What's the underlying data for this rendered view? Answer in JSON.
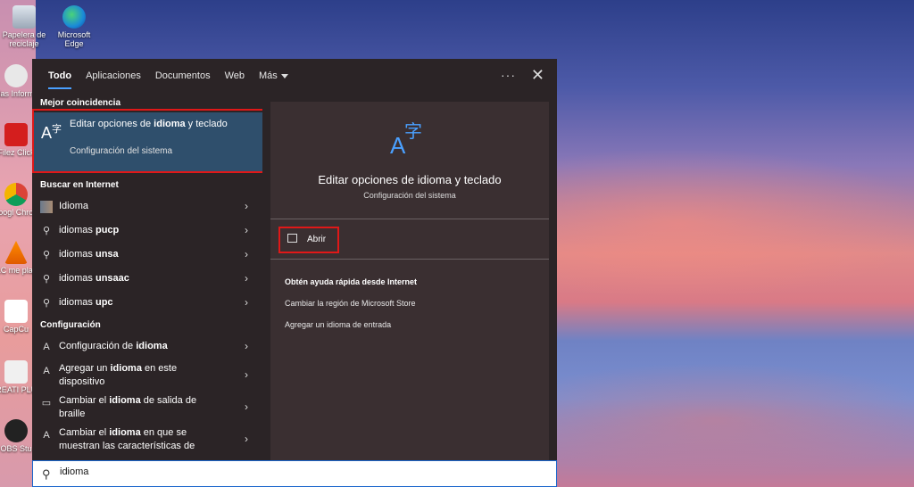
{
  "desktop": {
    "icons": [
      {
        "label": "Papelera de reciclaje"
      },
      {
        "label": "Microsoft Edge"
      },
      {
        "label": "Mas Informa"
      },
      {
        "label": "Filez Click"
      },
      {
        "label": "Googl Chrom"
      },
      {
        "label": "VLC me playe"
      },
      {
        "label": "CapCu"
      },
      {
        "label": "CREATI PLUS"
      },
      {
        "label": "OBS Stu"
      }
    ]
  },
  "search": {
    "tabs": [
      "Todo",
      "Aplicaciones",
      "Documentos",
      "Web",
      "Más"
    ],
    "more_menu": "···",
    "close": "✕",
    "best_match_header": "Mejor coincidencia",
    "best_match": {
      "title_pre": "Editar opciones de ",
      "title_bold": "idioma",
      "title_post": " y teclado",
      "subtitle": "Configuración del sistema"
    },
    "web_header": "Buscar en Internet",
    "web_results": [
      {
        "pre": "Idioma",
        "bold": ""
      },
      {
        "pre": "idiomas ",
        "bold": "pucp"
      },
      {
        "pre": "idiomas ",
        "bold": "unsa"
      },
      {
        "pre": "idiomas ",
        "bold": "unsaac"
      },
      {
        "pre": "idiomas ",
        "bold": "upc"
      }
    ],
    "settings_header": "Configuración",
    "settings_results": [
      {
        "pre": "Configuración de ",
        "bold": "idioma",
        "post": ""
      },
      {
        "pre": "Agregar un ",
        "bold": "idioma",
        "post": " en este dispositivo"
      },
      {
        "pre": "Cambiar el ",
        "bold": "idioma",
        "post": " de salida de braille"
      },
      {
        "pre": "Cambiar el ",
        "bold": "idioma",
        "post": " en que se muestran las características de"
      }
    ],
    "detail": {
      "title": "Editar opciones de idioma y teclado",
      "subtitle": "Configuración del sistema",
      "open_label": "Abrir",
      "help_header": "Obtén ayuda rápida desde Internet",
      "help_links": [
        "Cambiar la región de Microsoft Store",
        "Agregar un idioma de entrada"
      ]
    },
    "query": "idioma"
  },
  "colors": {
    "accent": "#4aa0ff",
    "highlight_outline": "#e01818",
    "panel": "#2b2426",
    "selected": "#2f4f6c"
  }
}
